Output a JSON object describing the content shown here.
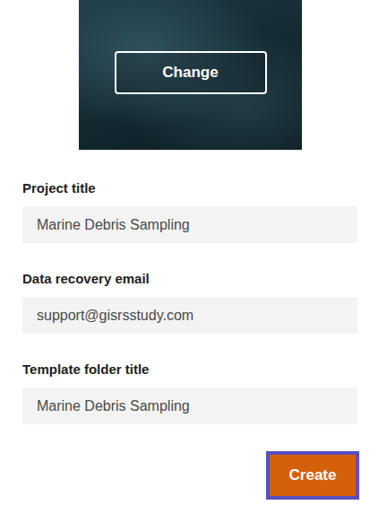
{
  "cover": {
    "button": "Change"
  },
  "fields": [
    {
      "label": "Project title",
      "value": "Marine Debris Sampling"
    },
    {
      "label": "Data recovery email",
      "value": "support@gisrsstudy.com"
    },
    {
      "label": "Template folder title",
      "value": "Marine Debris Sampling"
    }
  ],
  "create_button": {
    "label": "Create",
    "highlighted": true
  }
}
